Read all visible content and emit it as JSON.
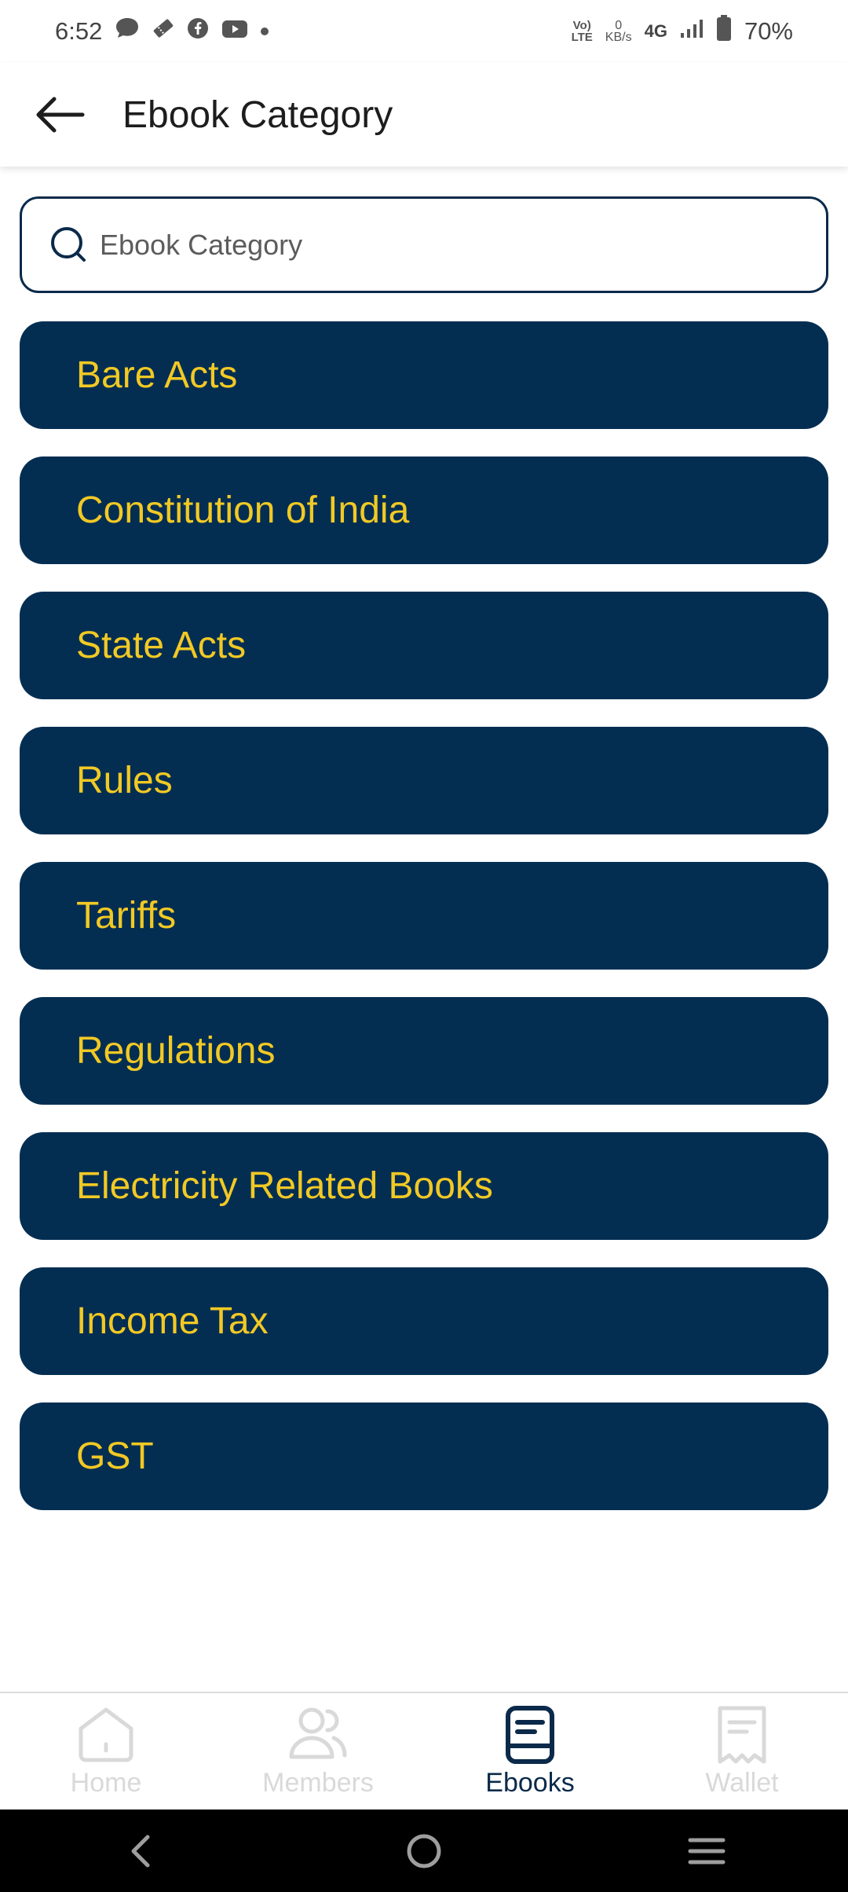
{
  "status_bar": {
    "time": "6:52",
    "network_lte_top": "Vo)",
    "network_lte_bottom": "LTE",
    "speed_value": "0",
    "speed_unit": "KB/s",
    "network_type": "4G",
    "battery": "70%",
    "icons": [
      "chat-icon",
      "ticket-icon",
      "facebook-icon",
      "youtube-icon",
      "dot-icon",
      "signal-icon",
      "battery-icon"
    ]
  },
  "app_bar": {
    "title": "Ebook Category"
  },
  "search": {
    "placeholder": "Ebook Category",
    "value": ""
  },
  "categories": [
    {
      "label": "Bare Acts"
    },
    {
      "label": "Constitution of India"
    },
    {
      "label": "State Acts"
    },
    {
      "label": "Rules"
    },
    {
      "label": "Tariffs"
    },
    {
      "label": "Regulations"
    },
    {
      "label": "Electricity Related Books"
    },
    {
      "label": "Income Tax"
    },
    {
      "label": "GST"
    }
  ],
  "bottom_nav": {
    "items": [
      {
        "label": "Home",
        "icon": "home-icon",
        "active": false
      },
      {
        "label": "Members",
        "icon": "members-icon",
        "active": false
      },
      {
        "label": "Ebooks",
        "icon": "ebooks-icon",
        "active": true
      },
      {
        "label": "Wallet",
        "icon": "wallet-icon",
        "active": false
      }
    ]
  },
  "colors": {
    "card_bg": "#032e52",
    "card_text": "#f2c924",
    "accent": "#0b2a4a",
    "inactive_nav": "#d9d9d9"
  }
}
